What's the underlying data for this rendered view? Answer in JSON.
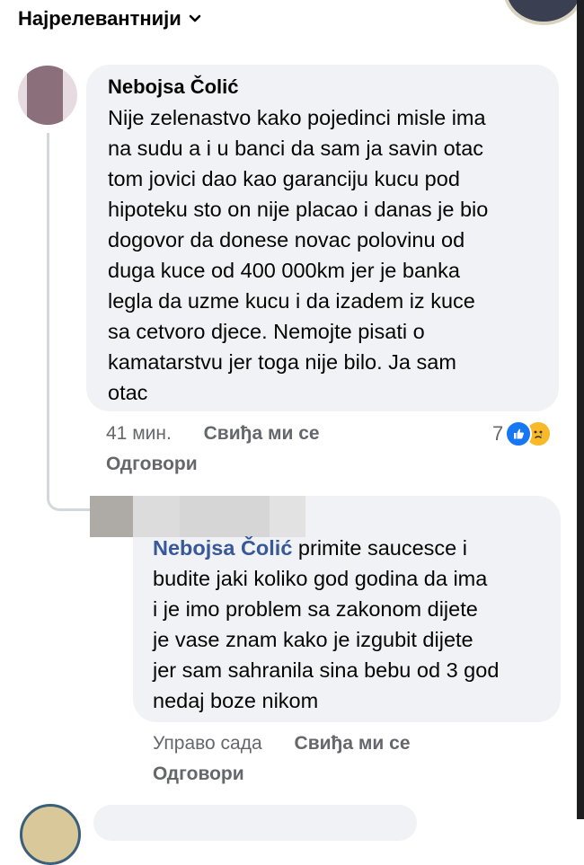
{
  "sort": {
    "label": "Најрелевантнији"
  },
  "comment1": {
    "author": "Nebojsa Čolić",
    "text": "Nije zelenastvo kako pojedinci misle ima\nna sudu a i u banci da sam ja savin otac\ntom jovici dao kao garanciju kucu pod\nhipoteku sto on nije placao i danas je bio\ndogovor da donese novac polovinu od\nduga kuce od 400 000km jer je banka\nlegla da uzme kucu i da izadem iz kuce\nsa cetvoro djece. Nemojte pisati o\nkamatarstvu jer toga nije bilo. Ja sam\notac",
    "time": "41 мин.",
    "like_label": "Свиђа ми се",
    "reply_label": "Одговори",
    "reaction_count": "7",
    "reactions": [
      "like-icon",
      "sad-icon"
    ]
  },
  "reply1": {
    "mention": "Nebojsa Čolić",
    "text": " primite saucesce i\nbudite jaki koliko god godina da ima\ni je imo problem sa zakonom dijete\nje vase znam kako je izgubit dijete\njer sam sahranila sina bebu od 3 god\nnedaj boze nikom",
    "time": "Управо сада",
    "like_label": "Свиђа ми се",
    "reply_label": "Одговори"
  },
  "colors": {
    "bubble_bg": "#f0f2f5",
    "mention": "#385898",
    "meta": "#65676b",
    "like_blue": "#1877f2",
    "sad_yellow": "#f7b928"
  }
}
